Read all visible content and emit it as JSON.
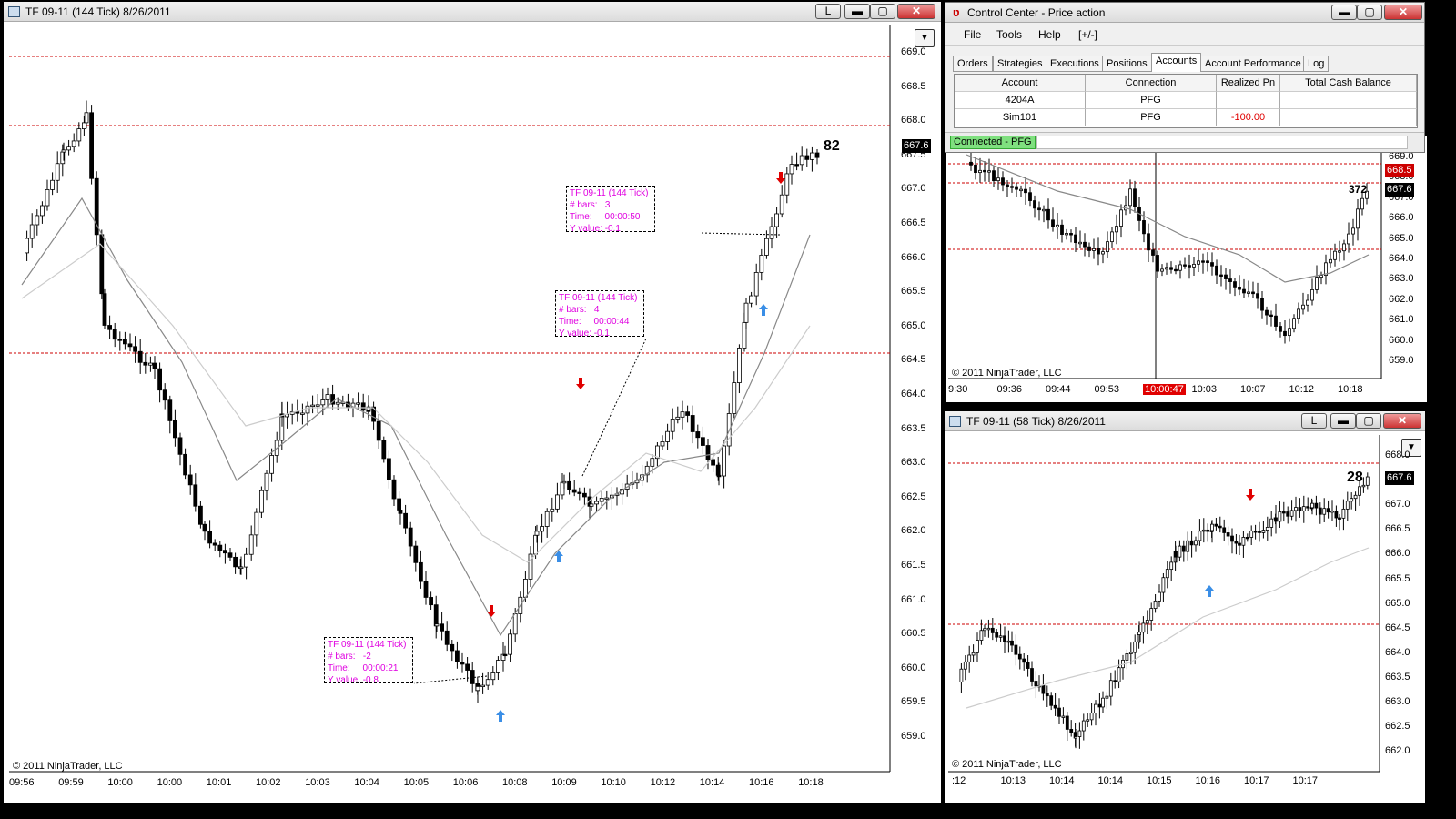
{
  "main_window": {
    "title": "TF 09-11 (144 Tick)  8/26/2011",
    "buttons": {
      "link": "L",
      "minimize": "▬",
      "maximize": "▢",
      "close": "✕"
    },
    "dropdown": "▼",
    "y_ticks": [
      "669.0",
      "668.5",
      "668.0",
      "667.5",
      "667.0",
      "666.5",
      "666.0",
      "665.5",
      "665.0",
      "664.5",
      "664.0",
      "663.5",
      "663.0",
      "662.5",
      "662.0",
      "661.5",
      "661.0",
      "660.5",
      "660.0",
      "659.5",
      "659.0"
    ],
    "x_ticks": [
      "09:56",
      "09:59",
      "10:00",
      "10:00",
      "10:01",
      "10:02",
      "10:03",
      "10:04",
      "10:05",
      "10:06",
      "10:08",
      "10:09",
      "10:10",
      "10:12",
      "10:14",
      "10:16",
      "10:18"
    ],
    "last_price": "667.6",
    "bar_count": "82",
    "copyright": "© 2011 NinjaTrader, LLC",
    "annotations": [
      {
        "line1": "TF 09-11 (144 Tick)",
        "line2": "# bars:   3",
        "line3": "Time:     00:00:50",
        "line4": "Y value: -0.1"
      },
      {
        "line1": "TF 09-11 (144 Tick)",
        "line2": "# bars:   4",
        "line3": "Time:     00:00:44",
        "line4": "Y value: -0.1"
      },
      {
        "line1": "TF 09-11 (144 Tick)",
        "line2": "# bars:   -2",
        "line3": "Time:     00:00:21",
        "line4": "Y value: -0.8"
      }
    ]
  },
  "control_center": {
    "title": "Control Center - Price action",
    "menu": [
      "File",
      "Tools",
      "Help",
      "[+/-]"
    ],
    "tabs": [
      "Orders",
      "Strategies",
      "Executions",
      "Positions",
      "Accounts",
      "Account Performance",
      "Log"
    ],
    "selected_tab": "Accounts",
    "columns": [
      "Account",
      "Connection",
      "Realized Pn",
      "Total Cash Balance"
    ],
    "rows": [
      {
        "account": "4204A",
        "connection": "PFG",
        "realized": "",
        "cash": ""
      },
      {
        "account": "Sim101",
        "connection": "PFG",
        "realized": "-100.00",
        "cash": ""
      }
    ],
    "status": "Connected - PFG"
  },
  "mid_chart": {
    "y_ticks": [
      "669.0",
      "668.0",
      "667.0",
      "666.0",
      "665.0",
      "664.0",
      "663.0",
      "662.0",
      "661.0",
      "660.0",
      "659.0"
    ],
    "x_ticks": [
      "9:30",
      "09:36",
      "09:44",
      "09:53",
      "10:00:47",
      "10:03",
      "10:07",
      "10:12",
      "10:18"
    ],
    "price_red": "668.5",
    "price_black": "667.6",
    "bar_count": "372",
    "copyright": "© 2011 NinjaTrader, LLC"
  },
  "bottom_window": {
    "title": "TF 09-11 (58 Tick)  8/26/2011",
    "buttons": {
      "link": "L",
      "minimize": "▬",
      "maximize": "▢",
      "close": "✕"
    },
    "dropdown": "▼",
    "y_ticks": [
      "668.0",
      "667.5",
      "667.0",
      "666.5",
      "666.0",
      "665.5",
      "665.0",
      "664.5",
      "664.0",
      "663.5",
      "663.0",
      "662.5",
      "662.0"
    ],
    "x_ticks": [
      ":12",
      "10:13",
      "10:14",
      "10:14",
      "10:15",
      "10:16",
      "10:17",
      "10:17"
    ],
    "last_price": "667.6",
    "bar_count": "28",
    "copyright": "© 2011 NinjaTrader, LLC"
  },
  "colors": {
    "up_arrow": "#3a8ee6",
    "down_arrow": "#e00000",
    "ref_line": "#cc0000",
    "annotation": "#e000e0"
  }
}
